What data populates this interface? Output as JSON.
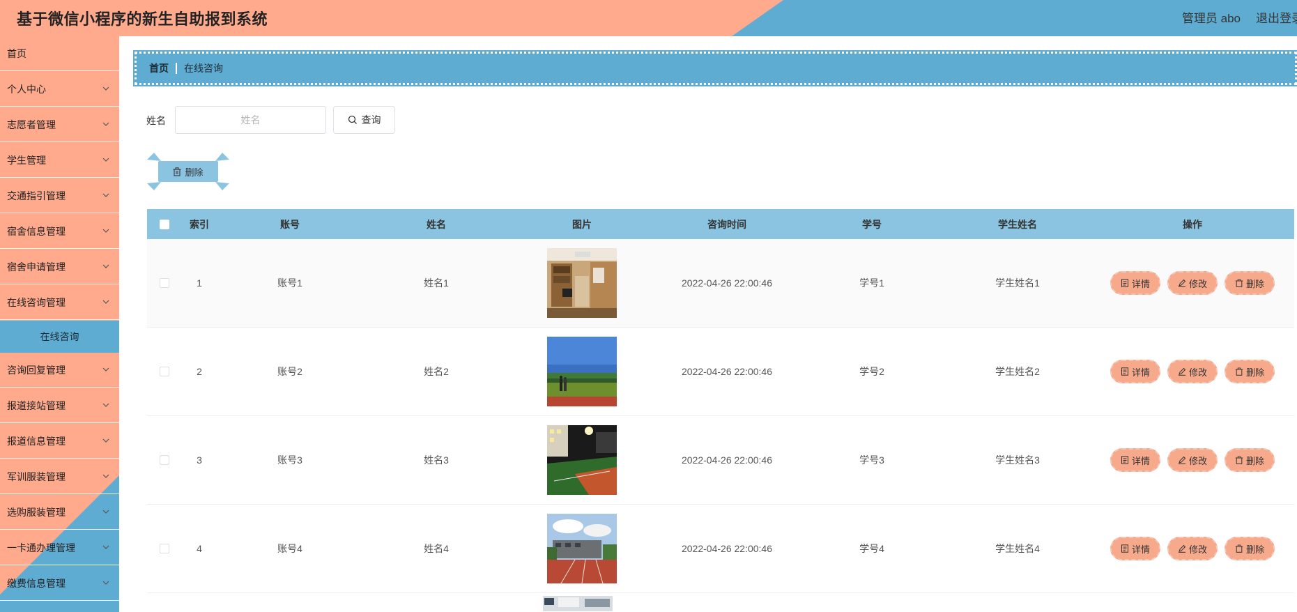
{
  "header": {
    "title": "基于微信小程序的新生自助报到系统",
    "user": "管理员 abo",
    "logout": "退出登录"
  },
  "colors": {
    "salmon": "#ffaa8c",
    "blue": "#5facd2",
    "light_blue": "#8ac4e0"
  },
  "sidebar": {
    "items": [
      {
        "label": "首页",
        "has_children": false
      },
      {
        "label": "个人中心",
        "has_children": true
      },
      {
        "label": "志愿者管理",
        "has_children": true
      },
      {
        "label": "学生管理",
        "has_children": true
      },
      {
        "label": "交通指引管理",
        "has_children": true
      },
      {
        "label": "宿舍信息管理",
        "has_children": true
      },
      {
        "label": "宿舍申请管理",
        "has_children": true
      },
      {
        "label": "在线咨询管理",
        "has_children": true
      }
    ],
    "active_sub": "在线咨询",
    "items_after": [
      {
        "label": "咨询回复管理",
        "has_children": true
      },
      {
        "label": "报道接站管理",
        "has_children": true
      },
      {
        "label": "报道信息管理",
        "has_children": true
      },
      {
        "label": "军训服装管理",
        "has_children": true
      },
      {
        "label": "选购服装管理",
        "has_children": true
      },
      {
        "label": "一卡通办理管理",
        "has_children": true
      },
      {
        "label": "缴费信息管理",
        "has_children": true
      }
    ]
  },
  "breadcrumb": {
    "home": "首页",
    "current": "在线咨询"
  },
  "search": {
    "label": "姓名",
    "placeholder": "姓名",
    "button": "查询"
  },
  "bulk_delete": "删除",
  "table": {
    "columns": [
      "索引",
      "账号",
      "姓名",
      "图片",
      "咨询时间",
      "学号",
      "学生姓名",
      "操作"
    ],
    "rows": [
      {
        "index": "1",
        "account": "账号1",
        "name": "姓名1",
        "image": "dorm-room",
        "time": "2022-04-26 22:00:46",
        "student_no": "学号1",
        "student_name": "学生姓名1"
      },
      {
        "index": "2",
        "account": "账号2",
        "name": "姓名2",
        "image": "sports-field-runners",
        "time": "2022-04-26 22:00:46",
        "student_no": "学号2",
        "student_name": "学生姓名2"
      },
      {
        "index": "3",
        "account": "账号3",
        "name": "姓名3",
        "image": "stadium-night",
        "time": "2022-04-26 22:00:46",
        "student_no": "学号3",
        "student_name": "学生姓名3"
      },
      {
        "index": "4",
        "account": "账号4",
        "name": "姓名4",
        "image": "running-track-building",
        "time": "2022-04-26 22:00:46",
        "student_no": "学号4",
        "student_name": "学生姓名4"
      }
    ],
    "actions": {
      "detail": "详情",
      "edit": "修改",
      "delete": "删除"
    }
  }
}
